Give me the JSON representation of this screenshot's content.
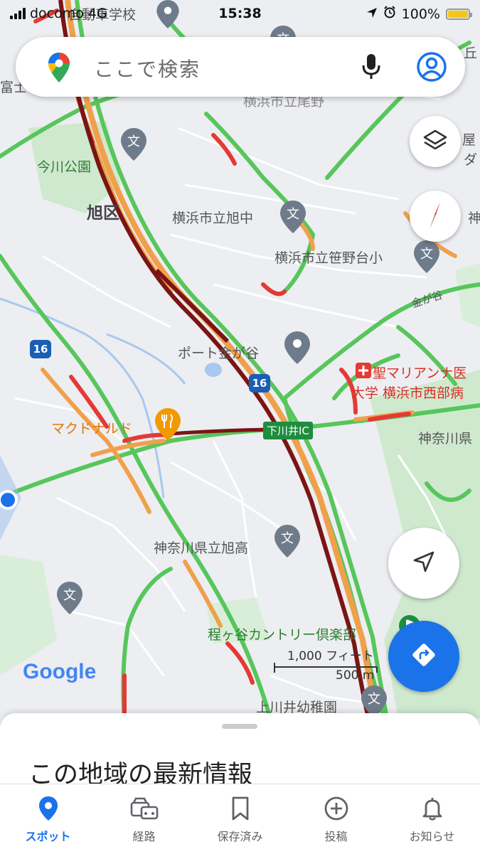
{
  "status_bar": {
    "carrier": "docomo",
    "network": "4G",
    "time": "15:38",
    "battery": "100%"
  },
  "search": {
    "placeholder": "ここで検索"
  },
  "map": {
    "labels": {
      "ward": "旭区",
      "park": "今川公園",
      "school_asahi_chu": "横浜市立旭中",
      "school_sasanodai": "横浜市立笹野台小",
      "port_kanagaya": "ポート金が谷",
      "hospital_line1": "聖マリアンナ医",
      "hospital_line2": "大学 横浜市西部病",
      "mcdonalds": "マクドナルド",
      "interchange": "下川井IC",
      "kanagawa_ken": "神奈川県",
      "school_asahi_ko": "神奈川県立旭高",
      "country_club": "程ヶ谷カントリー倶楽部",
      "kindergarten": "上川井幼稚園",
      "road_kanagaya": "金が谷",
      "route_16a": "16",
      "route_16b": "16",
      "top_school": "自動車学校",
      "top_truncated": "横浜市立尾野",
      "edge_right_1": "屋",
      "edge_right_2": "ダ",
      "edge_right_3": "神",
      "edge_left": "富士",
      "edge_top_right": "丘"
    },
    "scale": {
      "feet": "1,000 フィート",
      "meters": "500 m"
    },
    "logo": "Google"
  },
  "sheet": {
    "title": "この地域の最新情報"
  },
  "nav": {
    "items": [
      {
        "label": "スポット",
        "icon": "pin-icon",
        "active": true
      },
      {
        "label": "経路",
        "icon": "car-icon",
        "active": false
      },
      {
        "label": "保存済み",
        "icon": "bookmark-icon",
        "active": false
      },
      {
        "label": "投稿",
        "icon": "add-circle-icon",
        "active": false
      },
      {
        "label": "お知らせ",
        "icon": "bell-icon",
        "active": false
      }
    ]
  },
  "colors": {
    "traffic_green": "#57c65b",
    "traffic_orange": "#f0a04b",
    "traffic_red": "#e53935",
    "traffic_darkred": "#7b1414",
    "accent": "#1a73e8"
  }
}
